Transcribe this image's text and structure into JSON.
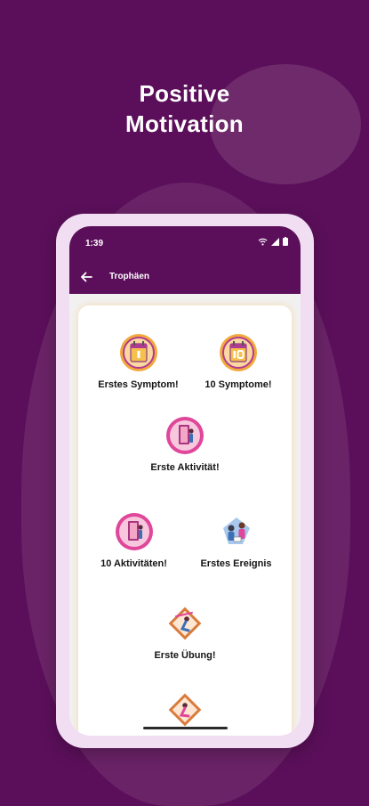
{
  "headline": {
    "line1": "Positive",
    "line2": "Motivation"
  },
  "status_bar": {
    "time": "1:39"
  },
  "toolbar": {
    "title": "Trophäen"
  },
  "trophies": [
    {
      "label": "Erstes Symptom!",
      "icon": "calendar-trophy-icon"
    },
    {
      "label": "10 Symptome!",
      "icon": "calendar-10-trophy-icon"
    },
    {
      "label": "Erste Aktivität!",
      "icon": "activity-door-trophy-icon"
    },
    {
      "label": "10 Aktivitäten!",
      "icon": "activity-door-trophy-icon"
    },
    {
      "label": "Erstes Ereignis",
      "icon": "people-event-icon"
    },
    {
      "label": "Erste Übung!",
      "icon": "exercise-diamond-icon"
    },
    {
      "label": "",
      "icon": "exercise-diamond-icon"
    }
  ],
  "colors": {
    "brand": "#5b0f5a",
    "badge_gold": "#f2a93b",
    "badge_pink": "#e0469a"
  }
}
